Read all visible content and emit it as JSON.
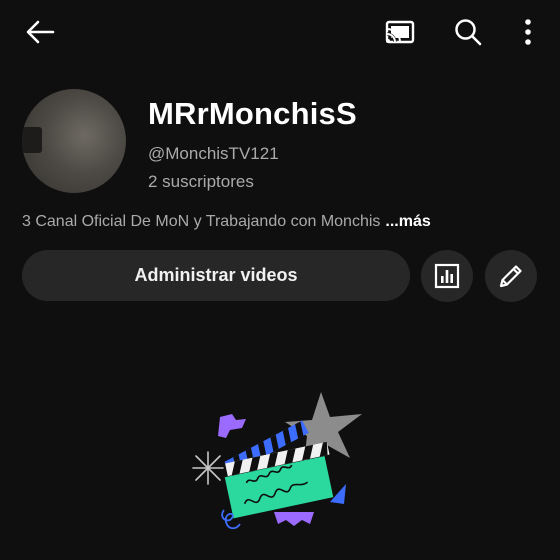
{
  "topbar": {
    "back_icon": "arrow-left-icon",
    "cast_icon": "cast-icon",
    "search_icon": "search-icon",
    "more_icon": "more-vertical-icon"
  },
  "channel": {
    "name": "MRrMonchisS",
    "handle": "@MonchisTV121",
    "subscribers": "2 suscriptores",
    "description": "3 Canal Oficial De MoN y Trabajando con Monchis",
    "more_label": "...más"
  },
  "actions": {
    "manage_videos_label": "Administrar videos",
    "analytics_icon": "analytics-icon",
    "edit_icon": "edit-pencil-icon"
  },
  "illustration": {
    "name": "clapperboard-illustration",
    "colors": {
      "board": "#2bd99f",
      "stripes": "#3d6bff",
      "star": "#8c8c8c",
      "purple": "#9b6bff",
      "blue": "#3c6dff"
    }
  }
}
